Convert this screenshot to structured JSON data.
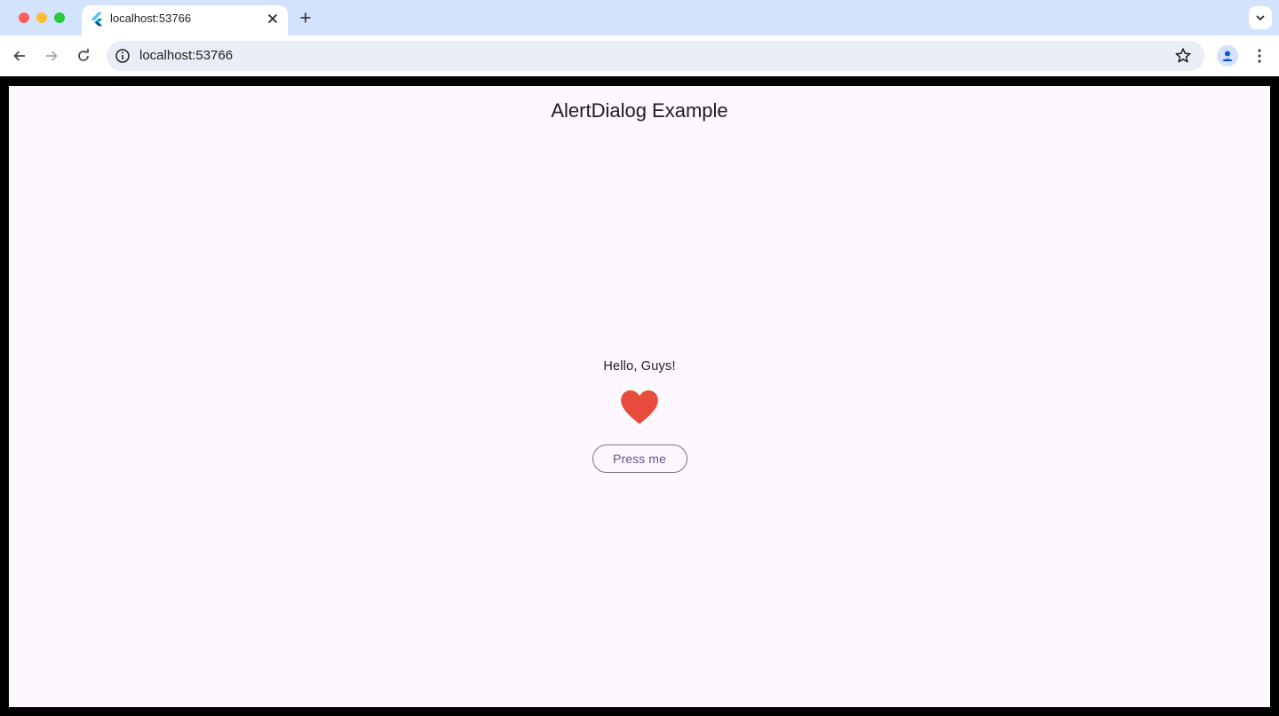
{
  "browser": {
    "tab": {
      "title": "localhost:53766"
    },
    "address_bar": {
      "url": "localhost:53766"
    },
    "icons": [
      "close-icon",
      "plus-icon",
      "chevron-down-icon",
      "back-arrow-icon",
      "forward-arrow-icon",
      "reload-icon",
      "info-icon",
      "star-icon",
      "profile-icon",
      "more-vert-icon",
      "flutter-logo-icon"
    ]
  },
  "page": {
    "appbar_title": "AlertDialog Example",
    "greeting": "Hello, Guys!",
    "heart_color": "#e74c3c",
    "button_label": "Press me"
  },
  "colors": {
    "page_background": "#fdf8fd",
    "button_text": "#65558f",
    "button_border": "#79747e",
    "tabstrip": "#d3e3fd",
    "omnibox": "#e9eef6"
  }
}
